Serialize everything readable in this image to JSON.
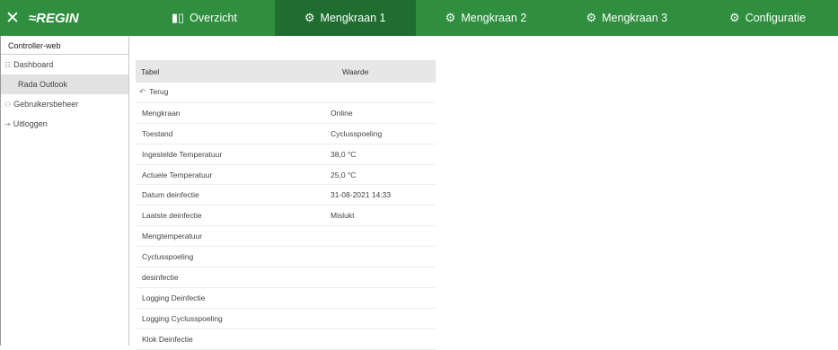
{
  "brand": {
    "close_glyph": "✕",
    "logo_mark": "≈",
    "name": "REGIN"
  },
  "tabs": [
    {
      "label": "Overzicht",
      "icon": "chart-icon",
      "active": false
    },
    {
      "label": "Mengkraan 1",
      "icon": "settings-icon",
      "active": true
    },
    {
      "label": "Mengkraan 2",
      "icon": "settings-icon",
      "active": false
    },
    {
      "label": "Mengkraan 3",
      "icon": "settings-icon",
      "active": false
    },
    {
      "label": "Configuratie",
      "icon": "settings-icon",
      "active": false
    }
  ],
  "sidebar": {
    "title": "Controller-web",
    "items": [
      {
        "label": "Dashboard",
        "icon": "dashboard-icon"
      },
      {
        "label": "Rada Outlook",
        "active": true
      },
      {
        "label": "Gebruikersbeheer",
        "icon": "users-icon"
      },
      {
        "label": "Uitloggen",
        "icon": "logout-icon"
      }
    ]
  },
  "table": {
    "headers": {
      "col1": "Tabel",
      "col2": "Waarde"
    },
    "back_label": "Terug",
    "rows": [
      {
        "name": "Mengkraan",
        "value": "Online"
      },
      {
        "name": "Toestand",
        "value": "Cyclusspoeling"
      },
      {
        "name": "Ingestelde Temperatuur",
        "value": "38,0 °C"
      },
      {
        "name": "Actuele Temperatuur",
        "value": "25,0 °C"
      },
      {
        "name": "Datum deinfectie",
        "value": "31-08-2021 14:33"
      },
      {
        "name": "Laatste deinfectie",
        "value": "Mislukt"
      },
      {
        "name": "Mengtemperatuur",
        "value": ""
      },
      {
        "name": "Cyclusspoeling",
        "value": ""
      },
      {
        "name": "desinfectie",
        "value": ""
      },
      {
        "name": "Logging Deinfectie",
        "value": ""
      },
      {
        "name": "Logging Cyclusspoeling",
        "value": ""
      },
      {
        "name": "Klok Deinfectie",
        "value": ""
      }
    ]
  },
  "colors": {
    "topbar": "#2f8f3f",
    "active_tab": "#1f6e30",
    "header_bg": "#e7e7e7"
  }
}
